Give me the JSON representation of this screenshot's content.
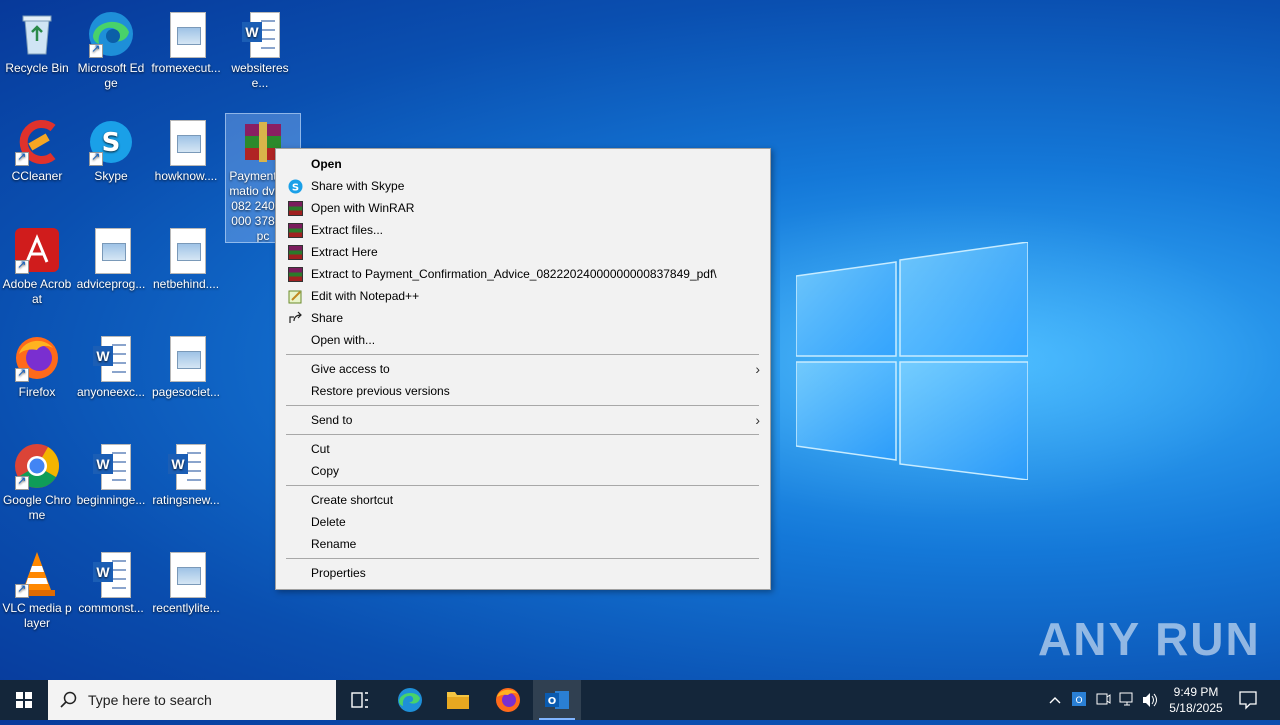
{
  "desktop": {
    "icons": [
      {
        "label": "Recycle Bin"
      },
      {
        "label": "Microsoft Edge"
      },
      {
        "label": "fromexecut..."
      },
      {
        "label": "websiterese..."
      },
      {
        "label": "CCleaner"
      },
      {
        "label": "Skype"
      },
      {
        "label": "howknow...."
      },
      {
        "label": "Payment_Confirmation_Advice_08222024000000000837849_pdf"
      },
      {
        "label": "Adobe Acrobat"
      },
      {
        "label": "adviceprog..."
      },
      {
        "label": "netbehind...."
      },
      {
        "label": "Firefox"
      },
      {
        "label": "anyoneexc..."
      },
      {
        "label": "pagesociet..."
      },
      {
        "label": "Google Chrome"
      },
      {
        "label": "beginninge..."
      },
      {
        "label": "ratingsnew..."
      },
      {
        "label": "VLC media player"
      },
      {
        "label": "commonst..."
      },
      {
        "label": "recentlylite..."
      }
    ],
    "selected_label_visible": "Payment nfirmatio dvice_082 240000000 37849_pc"
  },
  "context_menu": {
    "items": [
      {
        "label": "Open",
        "icon": "none"
      },
      {
        "label": "Share with Skype",
        "icon": "skype-icon"
      },
      {
        "label": "Open with WinRAR",
        "icon": "winrar-icon"
      },
      {
        "label": "Extract files...",
        "icon": "winrar-icon"
      },
      {
        "label": "Extract Here",
        "icon": "winrar-icon"
      },
      {
        "label": "Extract to Payment_Confirmation_Advice_08222024000000000837849_pdf\\",
        "icon": "winrar-icon"
      },
      {
        "label": "Edit with Notepad++",
        "icon": "notepadpp-icon"
      },
      {
        "label": "Share",
        "icon": "share-icon"
      },
      {
        "label": "Open with...",
        "icon": "none"
      },
      {
        "label": "Give access to",
        "submenu": true
      },
      {
        "label": "Restore previous versions"
      },
      {
        "label": "Send to",
        "submenu": true
      },
      {
        "label": "Cut"
      },
      {
        "label": "Copy"
      },
      {
        "label": "Create shortcut"
      },
      {
        "label": "Delete"
      },
      {
        "label": "Rename"
      },
      {
        "label": "Properties"
      }
    ]
  },
  "taskbar": {
    "search_placeholder": "Type here to search",
    "apps": [
      "task-view-icon",
      "edge-icon",
      "file-explorer-icon",
      "firefox-icon",
      "outlook-icon"
    ],
    "clock_time": "9:49 PM",
    "clock_date": "5/18/2025"
  },
  "watermark": "ANY RUN",
  "colors": {
    "desktop_blue": "#1478d8",
    "taskbar": "#14263a",
    "menu_bg": "#f2f2f2"
  }
}
